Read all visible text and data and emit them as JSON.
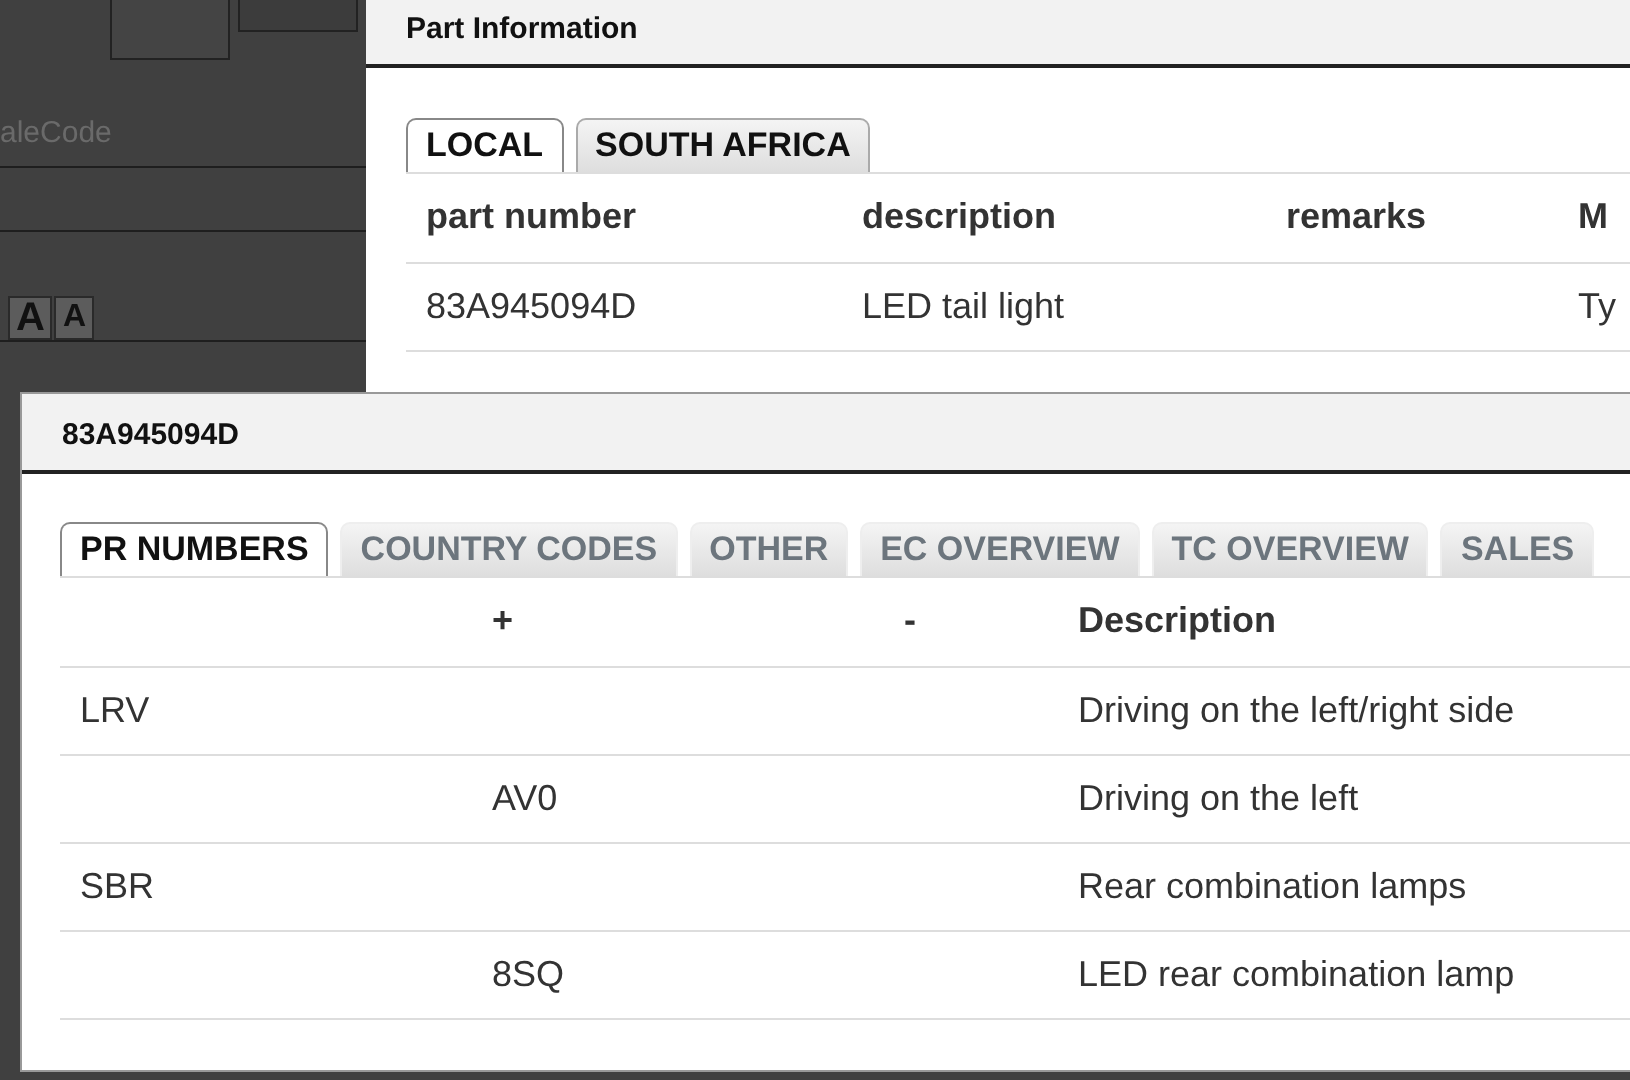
{
  "background": {
    "search": {
      "placeholder": "aleCode"
    },
    "font_buttons": [
      {
        "label": "A",
        "kind": "increase"
      },
      {
        "label": "A",
        "kind": "decrease"
      }
    ]
  },
  "part_dialog": {
    "title": "Part Information",
    "tabs": [
      {
        "label": "LOCAL",
        "selected": true
      },
      {
        "label": "SOUTH AFRICA",
        "selected": false
      }
    ],
    "columns": [
      "part number",
      "description",
      "remarks",
      "M"
    ],
    "rows": [
      [
        "83A945094D",
        "LED tail light",
        "",
        "Ty"
      ]
    ]
  },
  "detail_dialog": {
    "title": "83A945094D",
    "tabs": [
      {
        "label": "PR NUMBERS",
        "selected": true
      },
      {
        "label": "COUNTRY CODES",
        "selected": false
      },
      {
        "label": "OTHER",
        "selected": false
      },
      {
        "label": "EC OVERVIEW",
        "selected": false
      },
      {
        "label": "TC OVERVIEW",
        "selected": false
      },
      {
        "label": "SALES",
        "selected": false
      }
    ],
    "columns": [
      "",
      "+",
      "-",
      "Description"
    ],
    "rows": [
      [
        "LRV",
        "",
        "",
        "Driving on the left/right side"
      ],
      [
        "",
        "AV0",
        "",
        "Driving on the left"
      ],
      [
        "SBR",
        "",
        "",
        "Rear combination lamps"
      ],
      [
        "",
        "8SQ",
        "",
        "LED rear combination lamp"
      ]
    ]
  }
}
